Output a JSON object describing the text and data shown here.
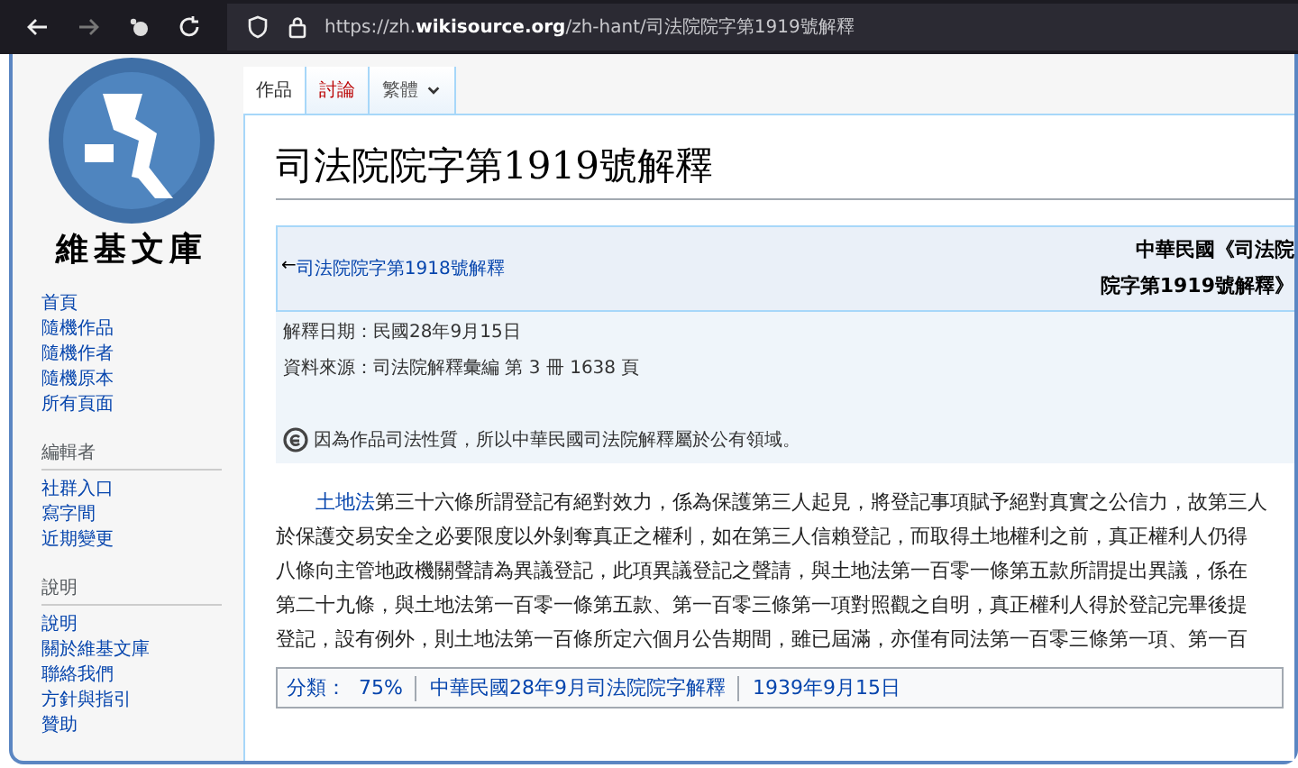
{
  "browser": {
    "url": "https://zh.**wikisource.org**/zh-hant/司法院院字第1919號解釋"
  },
  "sidebar": {
    "logo_text": "維基文庫",
    "sections": [
      {
        "items": [
          "首頁",
          "隨機作品",
          "隨機作者",
          "隨機原本",
          "所有頁面"
        ]
      },
      {
        "heading": "編輯者",
        "items": [
          "社群入口",
          "寫字間",
          "近期變更"
        ]
      },
      {
        "heading": "說明",
        "items": [
          "說明",
          "關於維基文庫",
          "聯絡我們",
          "方針與指引",
          "贊助"
        ]
      }
    ]
  },
  "tabs": [
    {
      "label": "作品",
      "selected": true,
      "kind": "page",
      "exists": true
    },
    {
      "label": "討論",
      "selected": false,
      "kind": "page",
      "exists": false
    },
    {
      "label": "繁體",
      "selected": false,
      "kind": "dropdown",
      "exists": true
    }
  ],
  "title": "司法院院字第1919號解釋",
  "header": {
    "prev_arrow": "←",
    "prev_link": "司法院院字第1918號解釋",
    "current_lines": [
      "中華民國《司法院",
      "院字第1919號解釋》"
    ]
  },
  "notes": [
    "解釋日期：民國28年9月15日",
    "資料來源：司法院解釋彙編 第 3 冊 1638 頁"
  ],
  "license": "因為作品司法性質，所以中華民國司法院解釋屬於公有領域。",
  "body": {
    "link": "土地法",
    "lines": [
      "第三十六條所謂登記有絕對效力，係為保護第三人起見，將登記事項賦予絕對真實之公信力，故第三人",
      "於保護交易安全之必要限度以外剝奪真正之權利，如在第三人信賴登記，而取得土地權利之前，真正權利人仍得",
      "八條向主管地政機關聲請為異議登記，此項異議登記之聲請，與土地法第一百零一條第五款所謂提出異議，係在",
      "第二十九條，與土地法第一百零一條第五款、第一百零三條第一項對照觀之自明，真正權利人得於登記完畢後提",
      "登記，設有例外，則土地法第一百條所定六個月公告期間，雖已屆滿，亦僅有同法第一百零三條第一項、第一百"
    ]
  },
  "categories": {
    "label": "分類：",
    "items": [
      "75%",
      "中華民國28年9月司法院院字解釋",
      "1939年9月15日"
    ]
  }
}
